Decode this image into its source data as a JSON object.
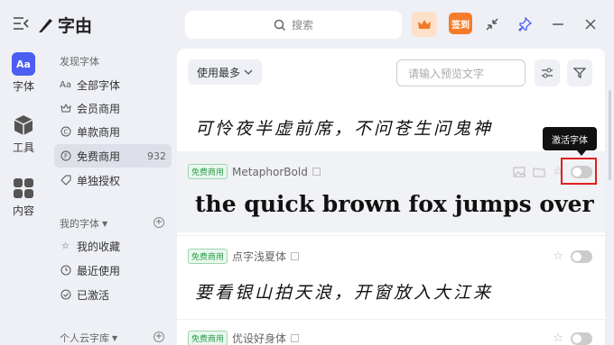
{
  "app": {
    "title": "字由"
  },
  "search": {
    "placeholder": "搜索"
  },
  "header": {
    "checkin_label": "签到"
  },
  "rail": {
    "items": [
      {
        "label": "字体",
        "badge": "Aa"
      },
      {
        "label": "工具"
      },
      {
        "label": "内容"
      }
    ]
  },
  "sidebar": {
    "discover_title": "发现字体",
    "discover_items": [
      {
        "label": "全部字体",
        "icon": "Aa"
      },
      {
        "label": "会员商用",
        "icon": "crown"
      },
      {
        "label": "单款商用",
        "icon": "C"
      },
      {
        "label": "免费商用",
        "icon": "F",
        "count": "932"
      },
      {
        "label": "单独授权",
        "icon": "tag"
      }
    ],
    "my_title": "我的字体",
    "my_items": [
      {
        "label": "我的收藏",
        "icon": "star"
      },
      {
        "label": "最近使用",
        "icon": "clock"
      },
      {
        "label": "已激活",
        "icon": "check"
      }
    ],
    "cloud_title": "个人云字库"
  },
  "main": {
    "sort_label": "使用最多",
    "preview_placeholder": "请输入预览文字",
    "top_sample": "可怜夜半虚前席，不问苍生问鬼神",
    "tooltip": "激活字体",
    "cards": [
      {
        "badge": "免费商用",
        "name": "MetaphorBold",
        "sample": "the quick brown fox jumps over t..."
      },
      {
        "badge": "免费商用",
        "name": "点字浅夏体",
        "sample": "要看银山拍天浪，开窗放入大江来"
      },
      {
        "badge": "免费商用",
        "name": "优设好身体",
        "sample": ""
      }
    ]
  }
}
